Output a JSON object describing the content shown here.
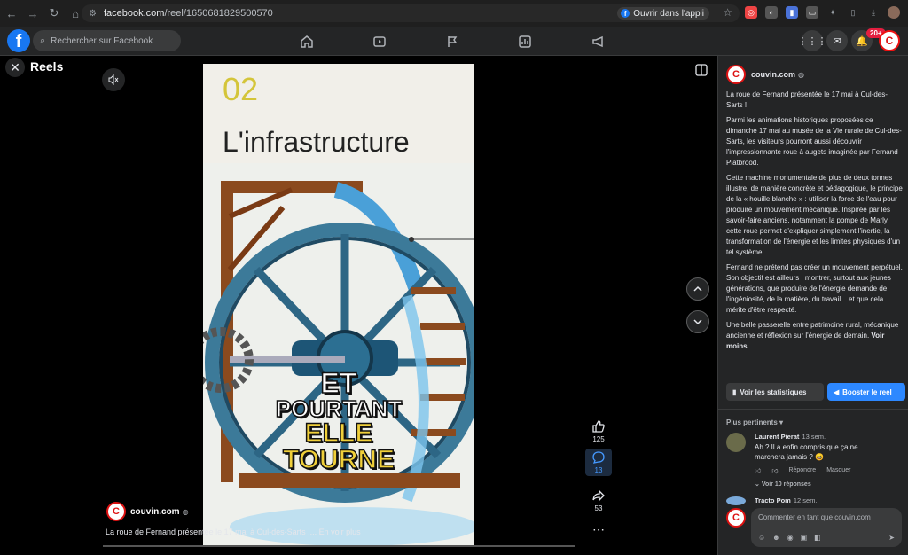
{
  "browser": {
    "url_domain": "facebook.com",
    "url_path": "/reel/1650681829500570",
    "open_app_label": "Ouvrir dans l'appli"
  },
  "fb_bar": {
    "search_placeholder": "Rechercher sur Facebook",
    "notification_count": "20+"
  },
  "reel": {
    "page_title": "Reels",
    "video_number": "02",
    "video_heading": "L'infrastructure",
    "overlay_lines": [
      "ET",
      "POURTANT",
      "ELLE",
      "TOURNE"
    ],
    "author": "couvin.com",
    "caption": "La roue de Fernand présentée le 17 mai à Cul-des-Sarts !... En voir plus",
    "likes": "125",
    "comments": "13",
    "shares": "53",
    "progress": 0.0
  },
  "panel": {
    "author": "couvin.com",
    "paragraphs": [
      "La roue de Fernand présentée le 17 mai à Cul-des-Sarts !",
      "Parmi les animations historiques proposées ce dimanche 17 mai au musée de la Vie rurale de Cul-des-Sarts, les visiteurs pourront aussi découvrir l'impressionnante roue à augets imaginée par Fernand Platbrood.",
      "Cette machine monumentale de plus de deux tonnes illustre, de manière concrète et pédagogique, le principe de la « houille blanche » : utiliser la force de l'eau pour produire un mouvement mécanique. Inspirée par les savoir-faire anciens, notamment la pompe de Marly, cette roue permet d'expliquer simplement l'inertie, la transformation de l'énergie et les limites physiques d'un tel système.",
      "Fernand ne prétend pas créer un mouvement perpétuel. Son objectif est ailleurs : montrer, surtout aux jeunes générations, que produire de l'énergie demande de l'ingéniosité, de la matière, du travail... et que cela mérite d'être respecté."
    ],
    "last_paragraph": "Une belle passerelle entre patrimoine rural, mécanique ancienne et réflexion sur l'énergie de demain.",
    "see_less": "Voir moins",
    "stats_button": "Voir les statistiques",
    "boost_button": "Booster le reel",
    "sort_label": "Plus pertinents",
    "comments": [
      {
        "name": "Laurent Pierat",
        "time": "13 sem.",
        "text": "Ah ? Il a enfin compris que ça ne marchera jamais ? 😄",
        "reply": "Répondre",
        "hide": "Masquer",
        "replies": "Voir 10 réponses"
      },
      {
        "name": "Tracto Pom",
        "time": "12 sem."
      }
    ],
    "comment_placeholder": "Commenter en tant que couvin.com"
  }
}
